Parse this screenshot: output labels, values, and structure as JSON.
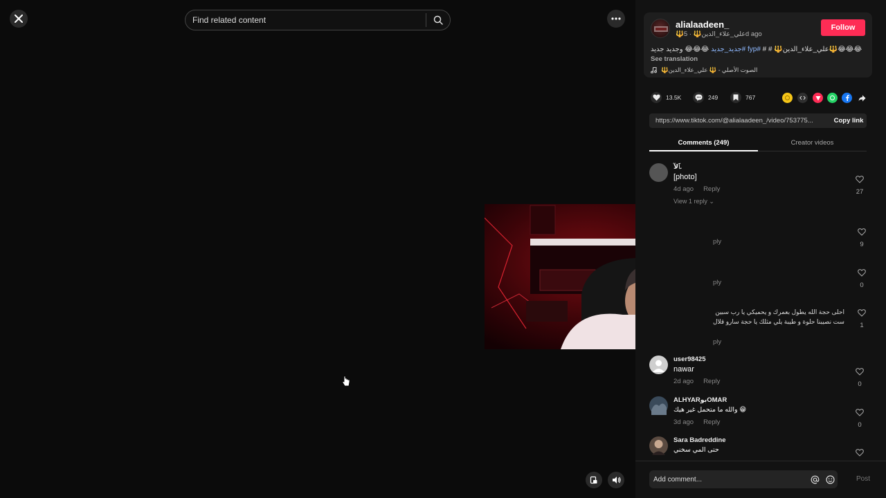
{
  "search": {
    "placeholder": "Find related content"
  },
  "author": {
    "username": "alialaadeen_",
    "display_name": "🔱علي_علاء_الدين🔱",
    "time": "5d ago",
    "follow_label": "Follow",
    "caption_text": "😂😂😂🔱علي_علاء_الدين🔱 # # ",
    "caption_tags": "#fyp #جديد_جديد",
    "caption_tail": " 😂😂😂 وجديد جديد",
    "see_translation": "See translation",
    "music": "🔱الصوت الأصلي - 🔱 علي_علاء_الدين"
  },
  "stats": {
    "likes": "13.5K",
    "comments": "249",
    "saves": "767"
  },
  "share_icons": [
    "coin-icon",
    "embed-icon",
    "tiktok-send-icon",
    "whatsapp-icon",
    "facebook-icon",
    "share-arrow-icon"
  ],
  "link": {
    "url": "https://www.tiktok.com/@alialaadeen_/video/753775...",
    "copy_label": "Copy link"
  },
  "tabs": [
    {
      "label": "Comments (249)",
      "active": true
    },
    {
      "label": "Creator videos",
      "active": false
    }
  ],
  "comments": [
    {
      "user": "ﭑﻟﺂ.",
      "text": "[photo]",
      "time": "4d ago",
      "reply": "Reply",
      "likes": "27",
      "view_replies": "View 1 reply"
    },
    {
      "user": "user98425",
      "text": "nawar",
      "time": "2d ago",
      "reply": "Reply",
      "likes": "0"
    },
    {
      "user": "ALHYARبوOMAR",
      "text": "والله ما متحمل غير هيك 😁",
      "time": "3d ago",
      "reply": "Reply",
      "likes": "0"
    },
    {
      "user": "Sara Badreddine",
      "text": "حتى المي سخني",
      "time": "",
      "reply": "",
      "likes": ""
    }
  ],
  "hidden_fragments": {
    "likes": [
      "9",
      "0",
      "1"
    ],
    "reply_word": "ply",
    "arabic_lines": [
      "احلى حجة الله يطول بعمرك و يحميكي يا رب سبين علي",
      "ست نصيبنا حلوة و طيبة يلي مثلك يا حجة سارو قلال"
    ]
  },
  "comment_input": {
    "placeholder": "Add comment...",
    "post_label": "Post"
  }
}
